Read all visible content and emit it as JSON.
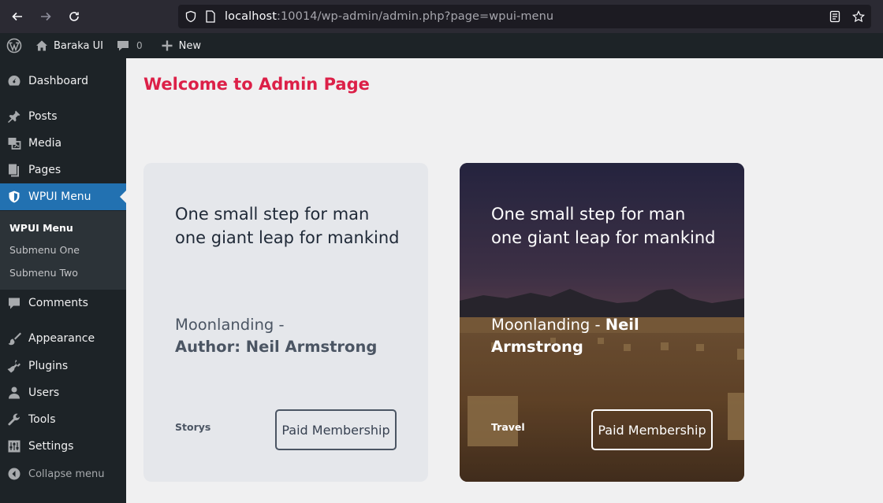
{
  "browser": {
    "url_host": "localhost",
    "url_rest": ":10014/wp-admin/admin.php?page=wpui-menu"
  },
  "adminbar": {
    "site_name": "Baraka UI",
    "comments_count": "0",
    "new_label": "New"
  },
  "sidebar": {
    "items": [
      {
        "label": "Dashboard",
        "icon": "dashboard-icon"
      },
      {
        "label": "Posts",
        "icon": "pin-icon"
      },
      {
        "label": "Media",
        "icon": "media-icon"
      },
      {
        "label": "Pages",
        "icon": "pages-icon"
      },
      {
        "label": "WPUI Menu",
        "icon": "shield-icon"
      },
      {
        "label": "Comments",
        "icon": "comment-icon"
      },
      {
        "label": "Appearance",
        "icon": "brush-icon"
      },
      {
        "label": "Plugins",
        "icon": "plug-icon"
      },
      {
        "label": "Users",
        "icon": "user-icon"
      },
      {
        "label": "Tools",
        "icon": "wrench-icon"
      },
      {
        "label": "Settings",
        "icon": "sliders-icon"
      }
    ],
    "submenu": [
      {
        "label": "WPUI Menu"
      },
      {
        "label": "Submenu One"
      },
      {
        "label": "Submenu Two"
      }
    ],
    "collapse_label": "Collapse menu"
  },
  "main": {
    "title": "Welcome to Admin Page",
    "cards": [
      {
        "quote_line1": "One small step for man",
        "quote_line2": "one giant leap for mankind",
        "meta_prefix": "Moonlanding -",
        "meta_bold": "Author: Neil Armstrong",
        "category": "Storys",
        "button": "Paid Membership"
      },
      {
        "quote_line1": "One small step for man",
        "quote_line2": "one giant leap for mankind",
        "meta_prefix": "Moonlanding -",
        "meta_bold": "Neil Armstrong",
        "category": "Travel",
        "button": "Paid Membership"
      }
    ]
  }
}
